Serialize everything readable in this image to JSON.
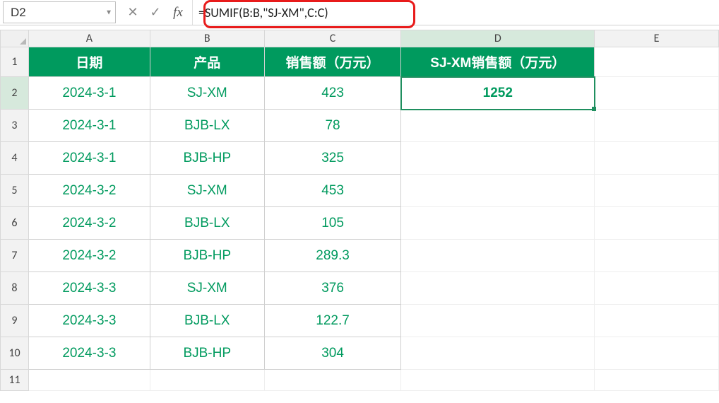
{
  "formula_bar": {
    "cell_ref": "D2",
    "formula": "=SUMIF(B:B,\"SJ-XM\",C:C)"
  },
  "columns": [
    "A",
    "B",
    "C",
    "D",
    "E"
  ],
  "row_numbers": [
    "1",
    "2",
    "3",
    "4",
    "5",
    "6",
    "7",
    "8",
    "9",
    "10",
    "11"
  ],
  "table": {
    "headers": {
      "A": "日期",
      "B": "产品",
      "C": "销售额（万元）",
      "D": "SJ-XM销售额（万元）"
    },
    "rows": [
      {
        "date": "2024-3-1",
        "product": "SJ-XM",
        "sales": "423"
      },
      {
        "date": "2024-3-1",
        "product": "BJB-LX",
        "sales": "78"
      },
      {
        "date": "2024-3-1",
        "product": "BJB-HP",
        "sales": "325"
      },
      {
        "date": "2024-3-2",
        "product": "SJ-XM",
        "sales": "453"
      },
      {
        "date": "2024-3-2",
        "product": "BJB-LX",
        "sales": "105"
      },
      {
        "date": "2024-3-2",
        "product": "BJB-HP",
        "sales": "289.3"
      },
      {
        "date": "2024-3-3",
        "product": "SJ-XM",
        "sales": "376"
      },
      {
        "date": "2024-3-3",
        "product": "BJB-LX",
        "sales": "122.7"
      },
      {
        "date": "2024-3-3",
        "product": "BJB-HP",
        "sales": "304"
      }
    ],
    "result": "1252"
  },
  "active_cell": "D2",
  "colors": {
    "accent": "#009a5e",
    "callout": "#e81b1b"
  }
}
